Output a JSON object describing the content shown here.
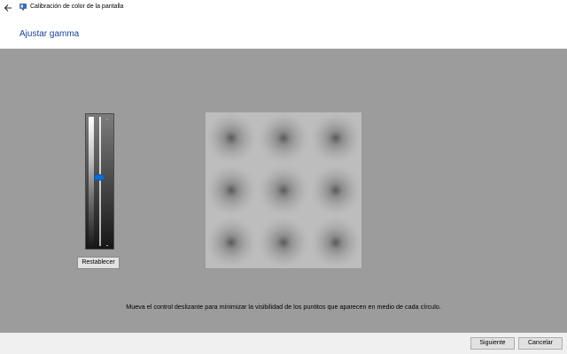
{
  "window": {
    "title": "Calibración de color de la pantalla",
    "back_icon": "back-arrow-icon",
    "app_icon": "display-calibration-icon"
  },
  "header": {
    "title": "Ajustar gamma",
    "title_color": "#1a3f9a"
  },
  "gamma_slider": {
    "level": 0.53,
    "thumb_color": "#0a6fd6"
  },
  "reset_label": "Restablecer",
  "sample_image": {
    "rows": 3,
    "cols": 3
  },
  "instruction": "Mueva el control deslizante para minimizar la visibilidad de los puntitos que aparecen en medio de cada círculo.",
  "footer": {
    "next_label": "Siguiente",
    "cancel_label": "Cancelar"
  },
  "colors": {
    "content_background": "#9c9c9c",
    "footer_background": "#f0f0f0"
  }
}
